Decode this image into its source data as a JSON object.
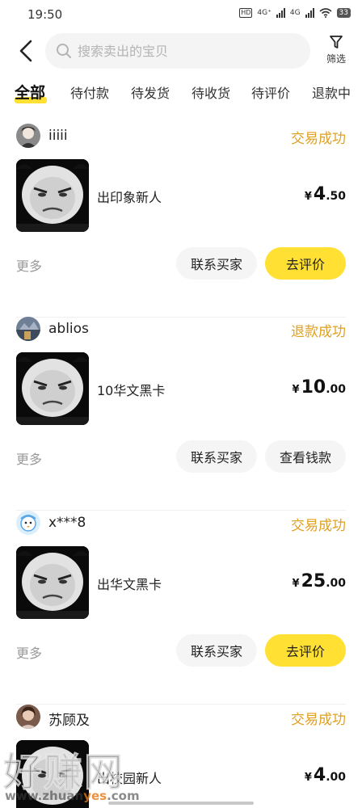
{
  "status_bar": {
    "time": "19:50",
    "hd_label": "HD",
    "net1": "4G⁺",
    "net2": "4G",
    "battery": "33"
  },
  "header": {
    "search_placeholder": "搜索卖出的宝贝",
    "filter_label": "筛选"
  },
  "tabs": [
    {
      "label": "全部",
      "active": true
    },
    {
      "label": "待付款"
    },
    {
      "label": "待发货"
    },
    {
      "label": "待收货"
    },
    {
      "label": "待评价"
    },
    {
      "label": "退款中"
    }
  ],
  "orders": [
    {
      "buyer": "iiiii",
      "status": "交易成功",
      "title": "出印象新人",
      "price_symbol": "¥",
      "price_int": "4",
      "price_dec": ".50",
      "more": "更多",
      "contact": "联系买家",
      "action": "去评价"
    },
    {
      "buyer": "ablios",
      "status": "退款成功",
      "title": "10华文黑卡",
      "price_symbol": "¥",
      "price_int": "10",
      "price_dec": ".00",
      "more": "更多",
      "contact": "联系买家",
      "action": "查看钱款"
    },
    {
      "buyer": "x***8",
      "status": "交易成功",
      "title": "出华文黑卡",
      "price_symbol": "¥",
      "price_int": "25",
      "price_dec": ".00",
      "more": "更多",
      "contact": "联系买家",
      "action": "去评价"
    },
    {
      "buyer": "苏顾及",
      "status": "交易成功",
      "title": "出校园新人",
      "price_symbol": "¥",
      "price_int": "4",
      "price_dec": ".00"
    }
  ],
  "watermark": {
    "text": "好赚网",
    "url_pre": "www.zhuan",
    "url_acc": "yes",
    "url_post": ".com"
  },
  "colors": {
    "accent_yellow": "#ffe033",
    "status_orange": "#e0a020",
    "muted": "#999999"
  }
}
